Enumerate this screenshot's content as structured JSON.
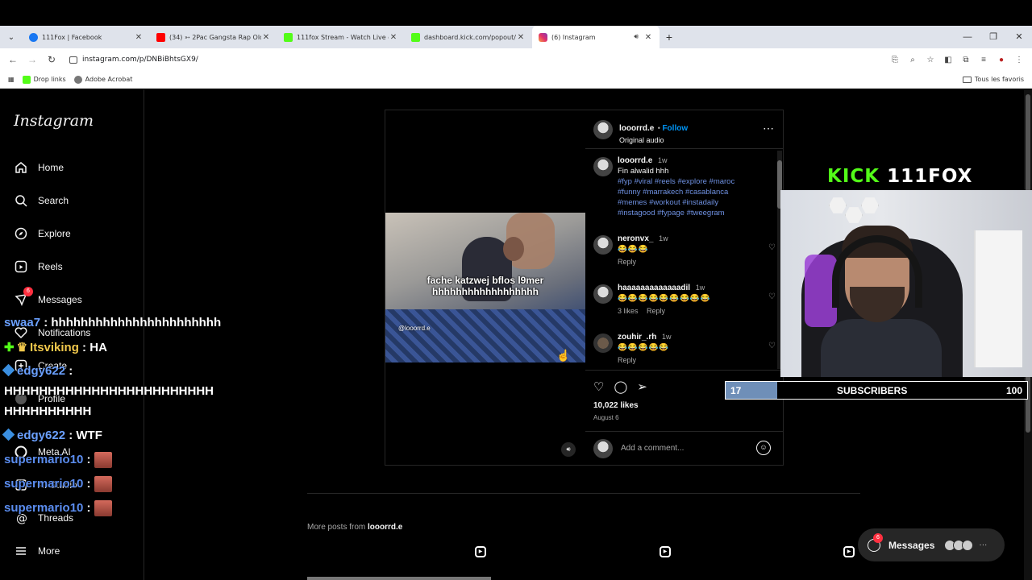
{
  "browser": {
    "tabs": [
      {
        "title": "111Fox | Facebook",
        "color": "#1877f2"
      },
      {
        "title": "(34) ➳ 2Pac Gangsta Rap Old S",
        "color": "#ff0000"
      },
      {
        "title": "111fox Stream - Watch Live on",
        "color": "#53fc18"
      },
      {
        "title": "dashboard.kick.com/popout/1",
        "color": "#53fc18"
      },
      {
        "title": "(6) Instagram",
        "color": "#e1306c"
      }
    ],
    "url": "instagram.com/p/DNBiBhtsGX9/",
    "bookmarks": [
      {
        "label": "Drop links",
        "color": "#53fc18"
      },
      {
        "label": "Adobe Acrobat",
        "color": "#777777"
      }
    ],
    "bookmarks_folder": "Tous les favoris"
  },
  "sidebar": {
    "logo": "Instagram",
    "items": [
      {
        "label": "Home",
        "icon": "home-icon"
      },
      {
        "label": "Search",
        "icon": "search-icon"
      },
      {
        "label": "Explore",
        "icon": "compass-icon"
      },
      {
        "label": "Reels",
        "icon": "reels-icon"
      },
      {
        "label": "Messages",
        "icon": "messenger-icon",
        "badge": "6"
      },
      {
        "label": "Notifications",
        "icon": "heart-icon"
      },
      {
        "label": "Create",
        "icon": "plus-icon"
      },
      {
        "label": "Profile",
        "icon": "avatar-icon"
      },
      {
        "label": "Meta AI",
        "icon": "meta-ai-icon"
      },
      {
        "label": "AI Studio",
        "icon": "ai-studio-icon"
      },
      {
        "label": "Threads",
        "icon": "threads-icon"
      },
      {
        "label": "More",
        "icon": "menu-icon"
      }
    ]
  },
  "post": {
    "author": "looorrd.e",
    "follow": "Follow",
    "audio": "Original audio",
    "video_caption_line1": "fache katzwej bflos l9mer",
    "video_caption_line2": "hhhhhhhhhhhhhhhhhh",
    "watermark": "@looorrd.e",
    "caption": {
      "user": "looorrd.e",
      "time": "1w",
      "text": "Fin alwalid hhh",
      "tags1": "#fyp #viral #reels #explore #maroc",
      "tags2": "#funny #marrakech #casablanca",
      "tags3": "#memes #workout #instadaily",
      "tags4": "#instagood #fypage #tweegram"
    },
    "comments": [
      {
        "user": "neronvx_",
        "time": "1w",
        "text": "😂😂😂",
        "meta": "Reply"
      },
      {
        "user": "haaaaaaaaaaaaadil",
        "time": "1w",
        "text": "😂😂😂😂😂😂😂😂😂",
        "meta_likes": "3 likes",
        "meta": "Reply"
      },
      {
        "user": "zouhir_.rh",
        "time": "1w",
        "text": "😂😂😂😂😂",
        "meta": "Reply"
      }
    ],
    "likes": "10,022 likes",
    "date": "August 6",
    "comment_placeholder": "Add a comment..."
  },
  "more_posts": {
    "prefix": "More posts from",
    "user": "looorrd.e"
  },
  "messages_pill": {
    "label": "Messages",
    "badge": "6"
  },
  "overlay": {
    "kick_word": "KICK",
    "channel": "111FOX",
    "sub_goal": {
      "current": "17",
      "label": "SUBSCRIBERS",
      "target": "100",
      "progress": 0.17,
      "color": "#6f8fb8"
    },
    "chat": [
      {
        "user": "swaa7",
        "sep": " : ",
        "msg": "hhhhhhhhhhhhhhhhhhhhhhh"
      },
      {
        "user": "Itsviking",
        "sep": " : ",
        "msg": "HA"
      },
      {
        "user": "edgy622",
        "sep": " :",
        "msg": ""
      },
      {
        "user": "",
        "sep": "",
        "msg": "HHHHHHHHHHHHHHHHHHHHHHHH"
      },
      {
        "user": "",
        "sep": "",
        "msg": "HHHHHHHHHH"
      },
      {
        "user": "edgy622",
        "sep": " : ",
        "msg": "WTF"
      },
      {
        "user": "supermario10",
        "sep": " : ",
        "msg": ""
      },
      {
        "user": "supermario10",
        "sep": " : ",
        "msg": ""
      },
      {
        "user": "supermario10",
        "sep": " : ",
        "msg": ""
      }
    ]
  },
  "colors": {
    "bg": "#000000",
    "link_blue": "#0095f6",
    "kick_green": "#53fc18",
    "badge_red": "#ff3040"
  }
}
